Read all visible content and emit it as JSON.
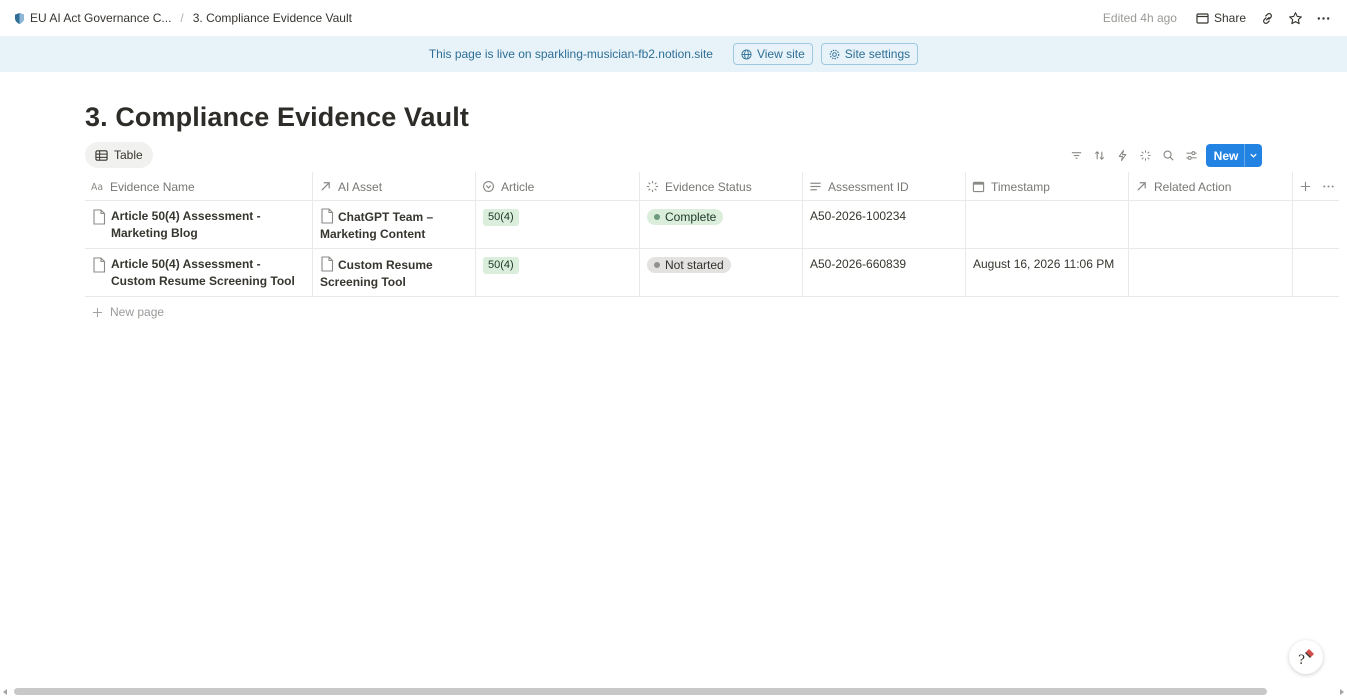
{
  "breadcrumb": {
    "parent": "EU AI Act Governance C...",
    "current": "3. Compliance Evidence Vault"
  },
  "topbar": {
    "edited": "Edited 4h ago",
    "share_label": "Share"
  },
  "banner": {
    "text": "This page is live on sparkling-musician-fb2.notion.site",
    "view_site": "View site",
    "site_settings": "Site settings"
  },
  "page": {
    "title": "3. Compliance Evidence Vault"
  },
  "view": {
    "tab_label": "Table",
    "new_label": "New"
  },
  "table": {
    "columns": [
      {
        "label": "Evidence Name",
        "icon": "title-aa-icon"
      },
      {
        "label": "AI Asset",
        "icon": "relation-arrow-icon"
      },
      {
        "label": "Article",
        "icon": "select-circle-icon"
      },
      {
        "label": "Evidence Status",
        "icon": "status-spinner-icon"
      },
      {
        "label": "Assessment ID",
        "icon": "text-lines-icon"
      },
      {
        "label": "Timestamp",
        "icon": "calendar-icon"
      },
      {
        "label": "Related Action",
        "icon": "relation-arrow-icon"
      }
    ],
    "rows": [
      {
        "name": "Article 50(4) Assessment - Marketing Blog",
        "asset": "ChatGPT Team – Marketing Content",
        "article": "50(4)",
        "status": "Complete",
        "assessment_id": "A50-2026-100234",
        "timestamp": "",
        "related_action": ""
      },
      {
        "name": "Article 50(4) Assessment - Custom Resume Screening Tool",
        "asset": "Custom Resume Screening Tool",
        "article": "50(4)",
        "status": "Not started",
        "assessment_id": "A50-2026-660839",
        "timestamp": "August 16, 2026 11:06 PM",
        "related_action": ""
      }
    ],
    "new_page_label": "New page"
  },
  "colors": {
    "banner_bg": "#e7f3f8",
    "accent": "#2383e2",
    "status_complete": "#dbeddb",
    "status_not_started": "#e3e2e0"
  }
}
